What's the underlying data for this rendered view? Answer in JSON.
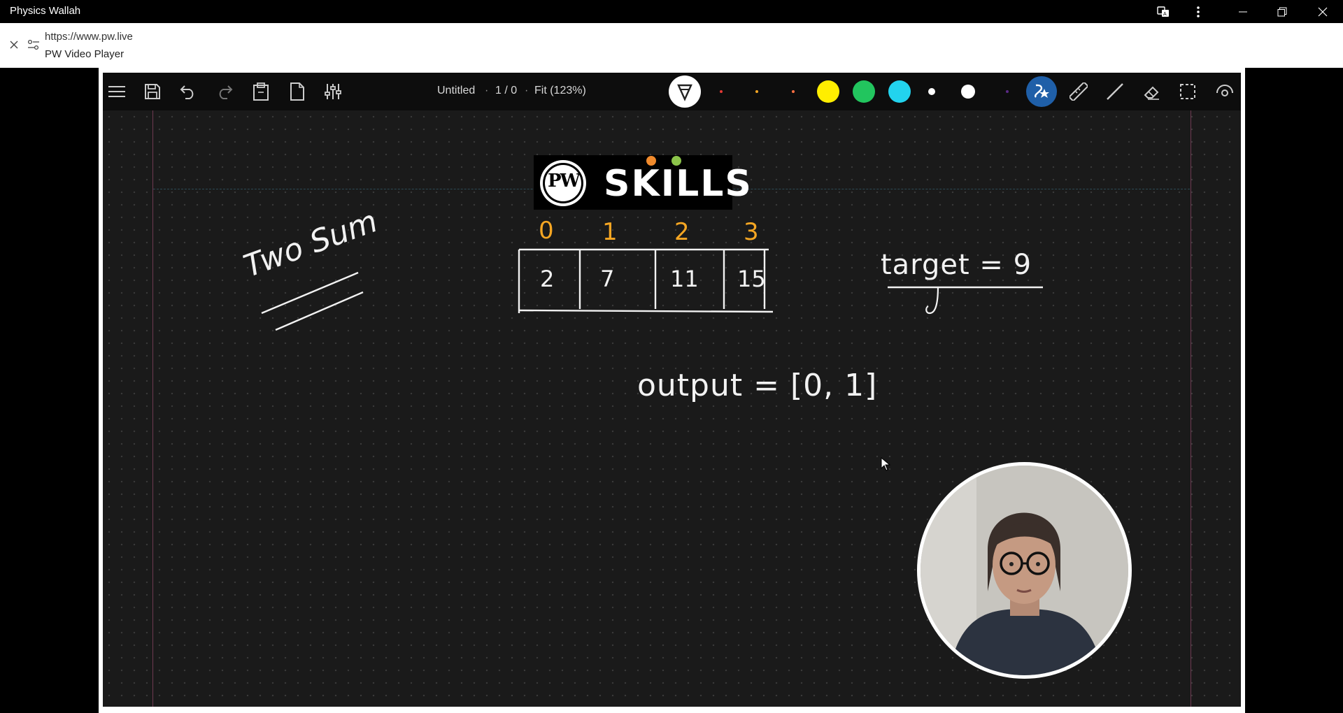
{
  "window": {
    "title": "Physics Wallah",
    "buttons": [
      "translate-icon",
      "more-icon",
      "minimize-icon",
      "restore-icon",
      "close-icon"
    ]
  },
  "address_bar": {
    "url": "https://www.pw.live",
    "page_title": "PW Video Player"
  },
  "whiteboard_toolbar": {
    "doc_name": "Untitled",
    "page": "1 / 0",
    "zoom": "Fit (123%)",
    "pen_colors": [
      "#e53935",
      "#f5a623",
      "#ff7043",
      "#ffee00",
      "#22c55e",
      "#22d3ee",
      "#ffffff",
      "#ffffff",
      "#5b2a86"
    ]
  },
  "logo": {
    "letters": "PW",
    "text": "SKILLS",
    "dot_colors": [
      "#f08a2c",
      "#8bc34a"
    ]
  },
  "board": {
    "heading": "Two Sum",
    "indices": [
      "0",
      "1",
      "2",
      "3"
    ],
    "array": [
      "2",
      "7",
      "11",
      "15"
    ],
    "target": "target = 9",
    "output": "output = [0, 1]"
  }
}
